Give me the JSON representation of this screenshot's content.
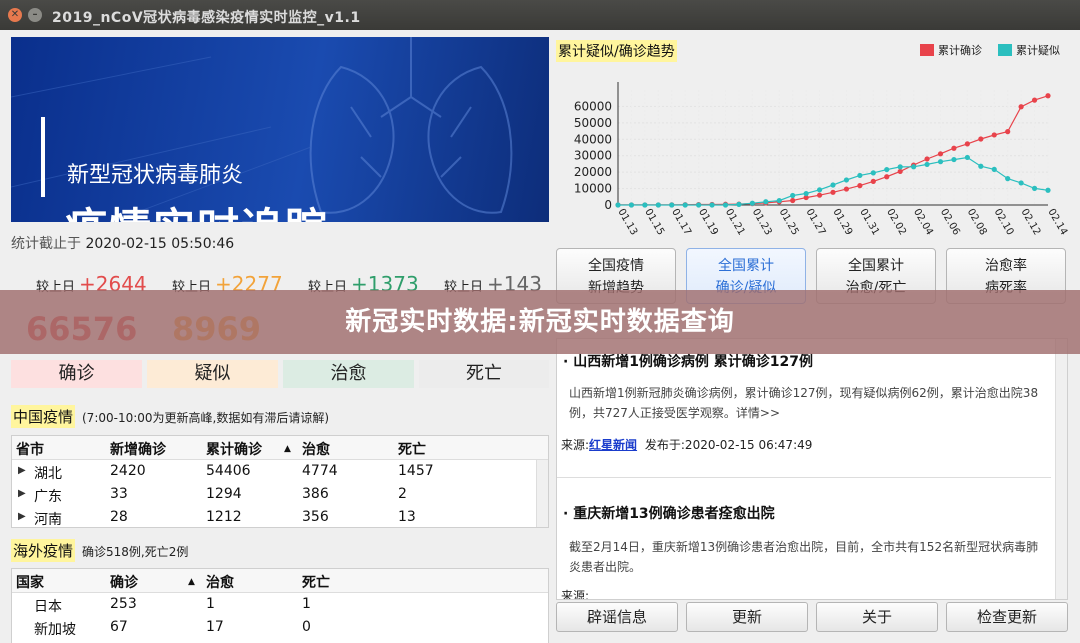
{
  "window": {
    "title": "2019_nCoV冠状病毒感染疫情实时监控_v1.1"
  },
  "banner": {
    "subtitle": "新型冠状病毒肺炎",
    "title": "疫情实时追踪"
  },
  "stats": {
    "time_label": "统计截止于",
    "time_value": "2020-02-15 05:50:46",
    "compare": [
      {
        "label": "较上日",
        "value": "+2644",
        "color": "#e24c4c"
      },
      {
        "label": "较上日",
        "value": "+2277",
        "color": "#f2a33a"
      },
      {
        "label": "较上日",
        "value": "+1373",
        "color": "#2f9e6b"
      },
      {
        "label": "较上日",
        "value": "+143",
        "color": "#666666"
      }
    ],
    "totals": [
      {
        "value": "66576",
        "color": "#e24c4c"
      },
      {
        "value": "8969",
        "color": "#f2a33a"
      }
    ],
    "categories": [
      {
        "label": "确诊",
        "bg": "#fde0e0"
      },
      {
        "label": "疑似",
        "bg": "#fdebd6"
      },
      {
        "label": "治愈",
        "bg": "#dcece3"
      },
      {
        "label": "死亡",
        "bg": "#ececec"
      }
    ]
  },
  "china": {
    "title": "中国疫情",
    "note": "(7:00-10:00为更新高峰,数据如有滞后请谅解)",
    "headers": [
      "省市",
      "新增确诊",
      "累计确诊",
      "治愈",
      "死亡"
    ],
    "rows": [
      [
        "湖北",
        "2420",
        "54406",
        "4774",
        "1457"
      ],
      [
        "广东",
        "33",
        "1294",
        "386",
        "2"
      ],
      [
        "河南",
        "28",
        "1212",
        "356",
        "13"
      ]
    ]
  },
  "overseas": {
    "title": "海外疫情",
    "note": "确诊518例,死亡2例",
    "headers": [
      "国家",
      "确诊",
      "治愈",
      "死亡"
    ],
    "rows": [
      [
        "日本",
        "253",
        "1",
        "1"
      ],
      [
        "新加坡",
        "67",
        "17",
        "0"
      ]
    ]
  },
  "chart_data": {
    "type": "line",
    "title": "累计疑似/确诊趋势",
    "x": [
      "01.13",
      "01.14",
      "01.15",
      "01.16",
      "01.17",
      "01.18",
      "01.19",
      "01.20",
      "01.21",
      "01.22",
      "01.23",
      "01.24",
      "01.25",
      "01.26",
      "01.27",
      "01.28",
      "01.29",
      "01.30",
      "01.31",
      "02.01",
      "02.02",
      "02.03",
      "02.04",
      "02.05",
      "02.06",
      "02.07",
      "02.08",
      "02.09",
      "02.10",
      "02.11",
      "02.12",
      "02.13",
      "02.14"
    ],
    "x_ticks": [
      "01.13",
      "01.15",
      "01.17",
      "01.19",
      "01.21",
      "01.23",
      "01.25",
      "01.27",
      "01.29",
      "01.31",
      "02.02",
      "02.04",
      "02.06",
      "02.08",
      "02.10",
      "02.12",
      "02.14"
    ],
    "y_ticks": [
      0,
      10000,
      20000,
      30000,
      40000,
      50000,
      60000
    ],
    "ylim": [
      0,
      70000
    ],
    "series": [
      {
        "name": "累计确诊",
        "color": "#e8434b",
        "values": [
          41,
          41,
          41,
          45,
          62,
          198,
          275,
          291,
          440,
          571,
          830,
          1287,
          1975,
          2744,
          4515,
          5974,
          7711,
          9692,
          11791,
          14380,
          17205,
          20438,
          24324,
          28018,
          31161,
          34546,
          37198,
          40171,
          42638,
          44653,
          59804,
          63851,
          66492
        ]
      },
      {
        "name": "累计疑似",
        "color": "#2bbfbf",
        "values": [
          0,
          0,
          0,
          0,
          0,
          0,
          0,
          0,
          0,
          393,
          1072,
          1965,
          2684,
          5794,
          6973,
          9239,
          12167,
          15238,
          17988,
          19544,
          21558,
          23214,
          23260,
          24702,
          26359,
          27657,
          28942,
          23589,
          21675,
          16067,
          13435,
          10109,
          8969
        ]
      }
    ],
    "grid": true,
    "legend": "top-right"
  },
  "tabs": [
    {
      "line1": "全国疫情",
      "line2": "新增趋势",
      "active": false
    },
    {
      "line1": "全国累计",
      "line2": "确诊/疑似",
      "active": true
    },
    {
      "line1": "全国累计",
      "line2": "治愈/死亡",
      "active": false
    },
    {
      "line1": "治愈率",
      "line2": "病死率",
      "active": false
    }
  ],
  "news": [
    {
      "title": "· 山西新增1例确诊病例 累计确诊127例",
      "body": "山西新增1例新冠肺炎确诊病例，累计确诊127例，现有疑似病例62例，累计治愈出院38例，共727人正接受医学观察。详情>>",
      "source_label": "来源:",
      "source": "红星新闻",
      "published": "发布于:2020-02-15 06:47:49"
    },
    {
      "title": "· 重庆新增13例确诊患者痊愈出院",
      "body": "截至2月14日，重庆新增13例确诊患者治愈出院，目前，全市共有152名新型冠状病毒肺炎患者出院。",
      "source_label": "来源:",
      "source": "",
      "published": ""
    }
  ],
  "bottom_buttons": [
    "辟谣信息",
    "更新",
    "关于",
    "检查更新"
  ],
  "overlay": {
    "text": "新冠实时数据:新冠实时数据查询"
  }
}
